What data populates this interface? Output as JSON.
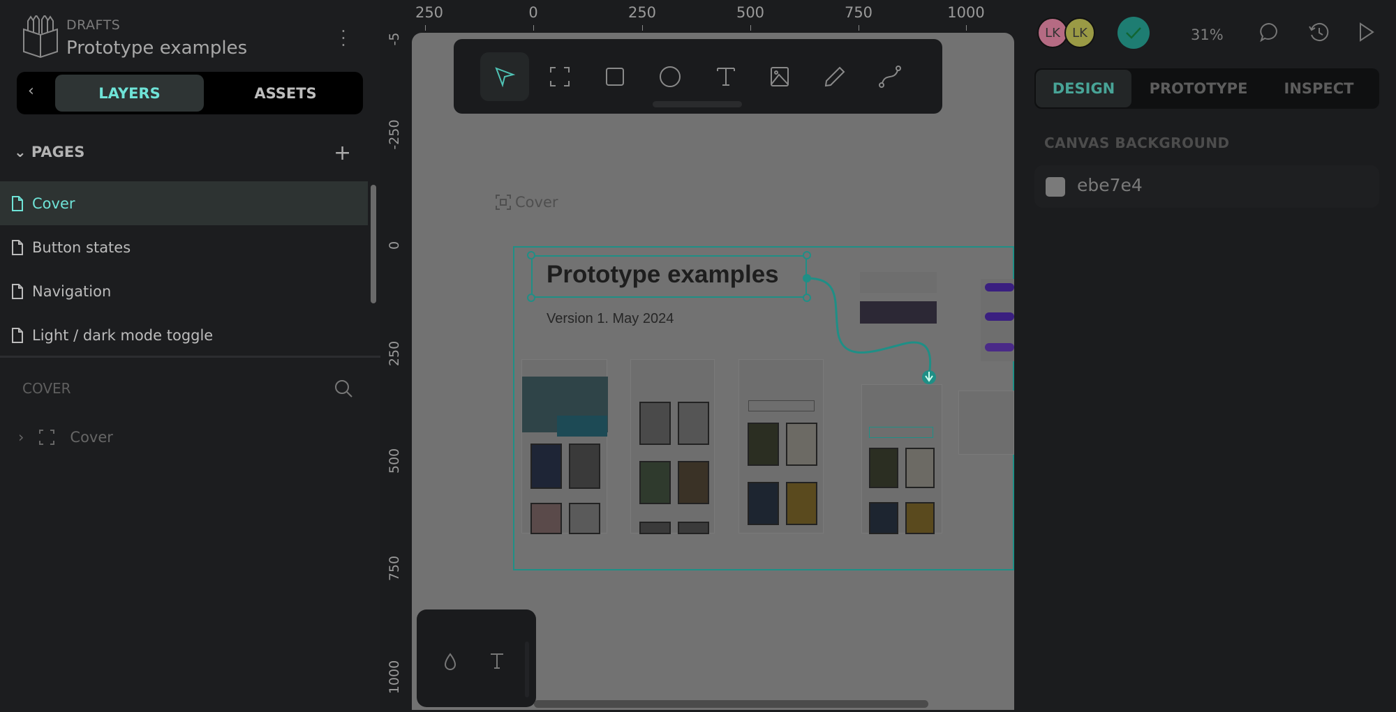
{
  "header": {
    "section": "DRAFTS",
    "title": "Prototype examples"
  },
  "left_tabs": {
    "layers": "LAYERS",
    "assets": "ASSETS"
  },
  "pages": {
    "heading": "PAGES",
    "items": [
      {
        "label": "Cover",
        "selected": true
      },
      {
        "label": "Button states"
      },
      {
        "label": "Navigation"
      },
      {
        "label": "Light / dark mode toggle"
      }
    ]
  },
  "layers": {
    "heading": "COVER",
    "items": [
      {
        "label": "Cover"
      }
    ]
  },
  "rulers": {
    "top": [
      "250",
      "0",
      "250",
      "500",
      "750",
      "1000"
    ],
    "left": [
      "-5",
      "-250",
      "0",
      "250",
      "500",
      "750",
      "1000"
    ]
  },
  "toolbar": {
    "tools": [
      "pointer-icon",
      "frame-icon",
      "rectangle-icon",
      "ellipse-icon",
      "text-icon",
      "image-icon",
      "pencil-icon",
      "path-icon"
    ],
    "selected": "pointer-icon"
  },
  "canvas": {
    "board_label": "Cover",
    "board_title": "Prototype examples",
    "board_subtitle": "Version 1. May 2024"
  },
  "right_panel": {
    "avatars": [
      {
        "initials": "LK",
        "color": "#b56b83"
      },
      {
        "initials": "LK",
        "color": "#9a9a45"
      }
    ],
    "zoom": "31%",
    "tabs": [
      {
        "label": "DESIGN",
        "selected": true
      },
      {
        "label": "PROTOTYPE"
      },
      {
        "label": "INSPECT"
      }
    ],
    "canvas_background_label": "CANVAS BACKGROUND",
    "canvas_background_value": "ebe7e4"
  },
  "colors": {
    "accent": "#6fe3d7",
    "board_stroke": "#1f8f86",
    "canvas": "#727272"
  }
}
